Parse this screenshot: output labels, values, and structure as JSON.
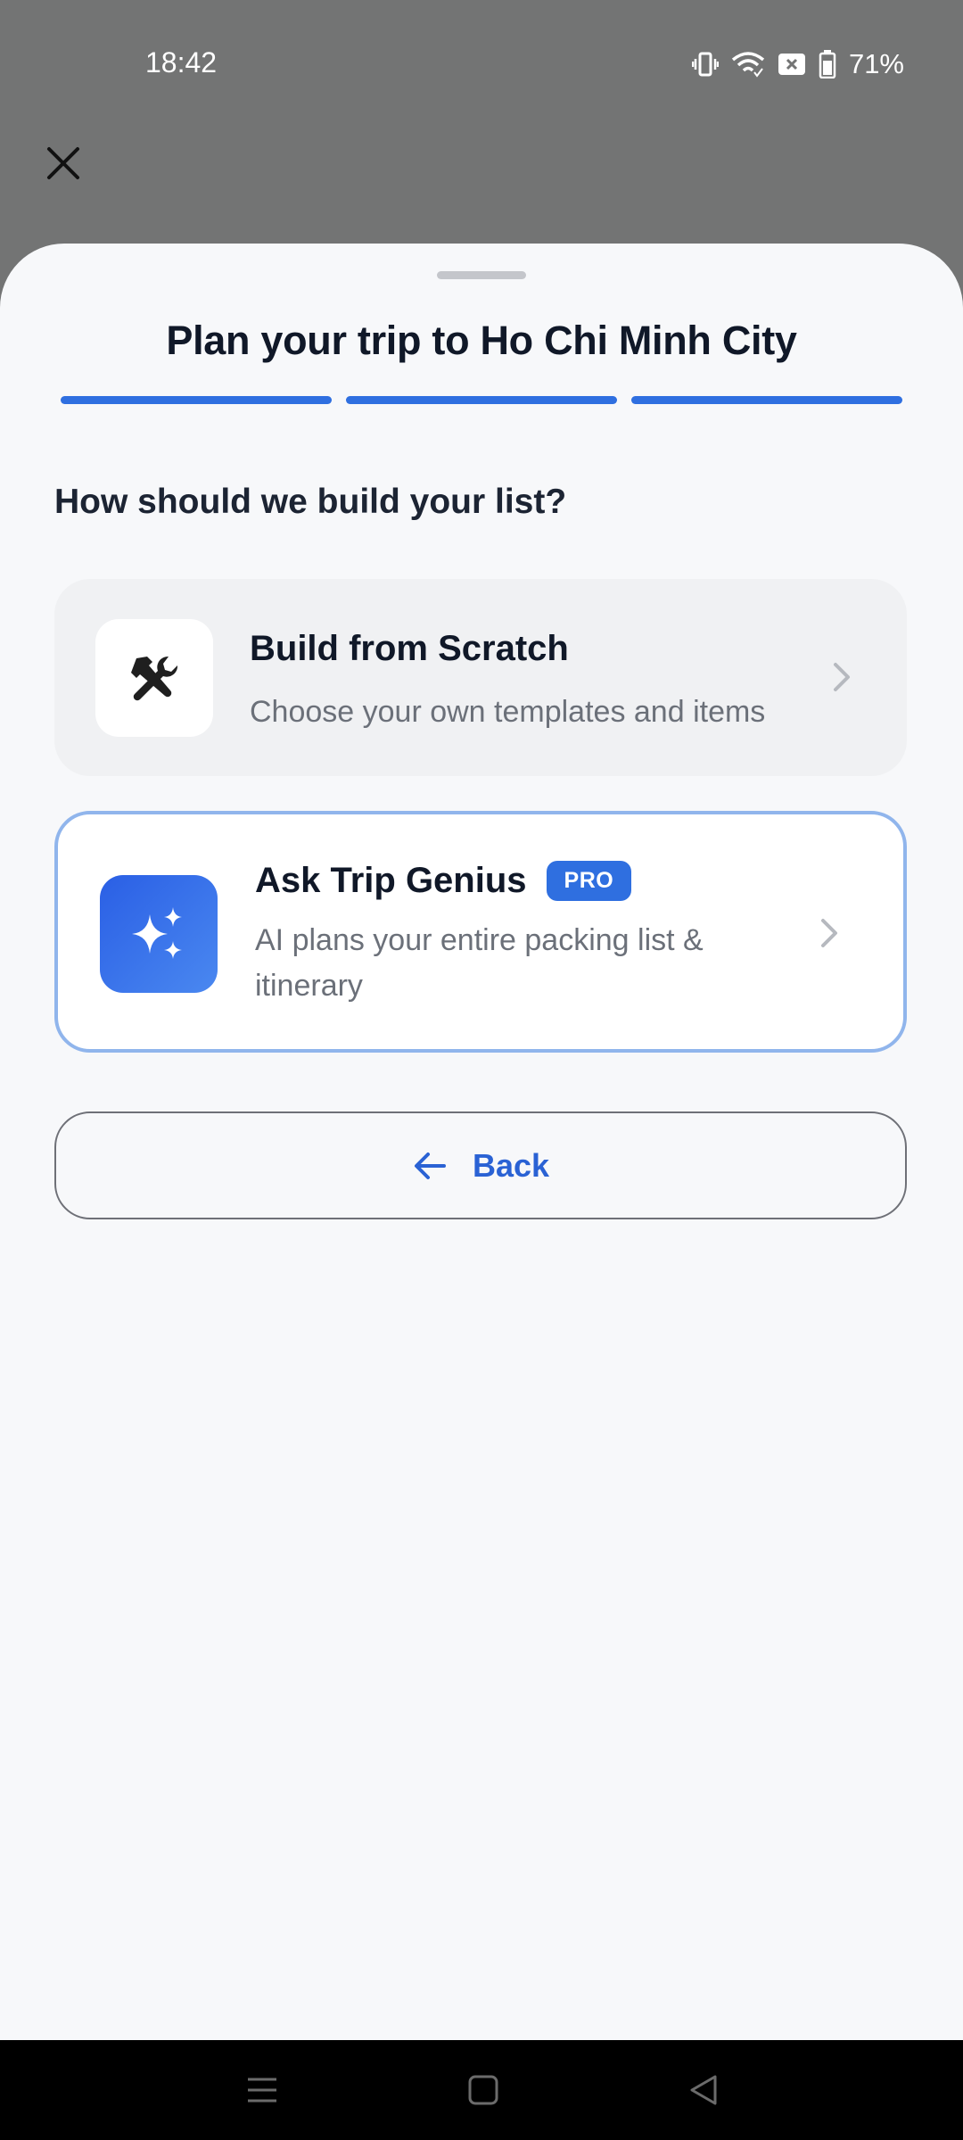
{
  "status_bar": {
    "time": "18:42",
    "battery": "71%",
    "icons": [
      "vibrate-icon",
      "wifi-icon",
      "no-sim-icon",
      "battery-icon"
    ]
  },
  "sheet": {
    "title": "Plan your trip to Ho Chi Minh City",
    "progress": {
      "completed_steps": 3,
      "total_steps": 3
    },
    "question": "How should we build your list?",
    "options": [
      {
        "title": "Build from Scratch",
        "subtitle": "Choose your own templates and items",
        "icon": "tools-icon"
      },
      {
        "title": "Ask Trip Genius",
        "badge": "PRO",
        "subtitle": "AI plans your entire packing list & itinerary",
        "icon": "sparkles-icon"
      }
    ],
    "back_label": "Back"
  },
  "colors": {
    "accent": "#2f6fe0",
    "selected_border": "#90b5ec",
    "sheet_background": "#f7f8fa",
    "scrim": "#737474"
  }
}
